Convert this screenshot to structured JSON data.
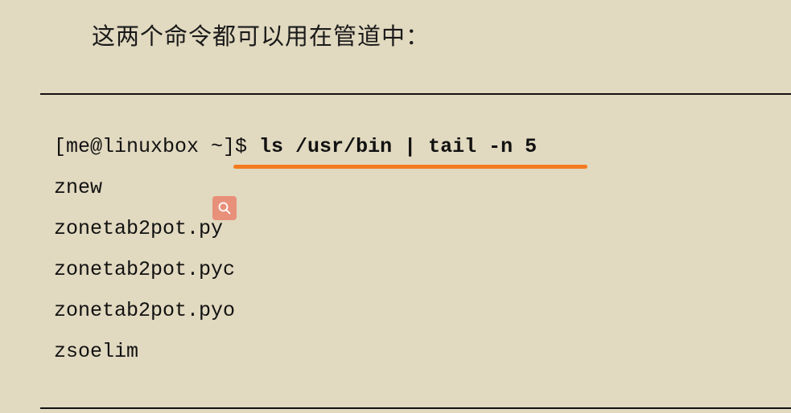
{
  "intro_text": "这两个命令都可以用在管道中：",
  "terminal": {
    "prompt": "[me@linuxbox ~]$ ",
    "command": "ls /usr/bin | tail -n 5",
    "output": [
      "znew",
      "zonetab2pot.py",
      "zonetab2pot.pyc",
      "zonetab2pot.pyo",
      "zsoelim"
    ]
  },
  "colors": {
    "background": "#e1d9c0",
    "highlight_underline": "#f47a20",
    "search_badge": "#e8907a"
  },
  "icons": {
    "search_badge": "search-icon"
  }
}
